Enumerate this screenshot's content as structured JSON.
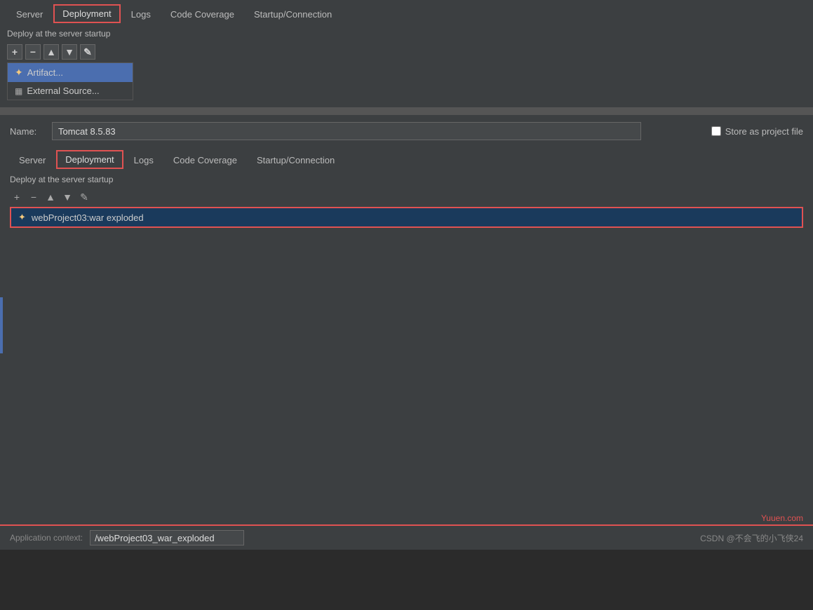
{
  "top_panel": {
    "tabs": [
      {
        "label": "Server",
        "active": false
      },
      {
        "label": "Deployment",
        "active": true
      },
      {
        "label": "Logs",
        "active": false
      },
      {
        "label": "Code Coverage",
        "active": false
      },
      {
        "label": "Startup/Connection",
        "active": false
      }
    ],
    "deploy_label": "Deploy at the server startup",
    "toolbar": {
      "add": "+",
      "remove": "−",
      "up": "▲",
      "down": "▼",
      "edit": "✎"
    },
    "dropdown": {
      "items": [
        {
          "label": "Artifact...",
          "selected": true,
          "icon": "artifact"
        },
        {
          "label": "External Source...",
          "selected": false,
          "icon": "ext"
        }
      ]
    }
  },
  "bottom_panel": {
    "name_label": "Name:",
    "name_value": "Tomcat 8.5.83",
    "store_label": "Store as project file",
    "tabs": [
      {
        "label": "Server",
        "active": false
      },
      {
        "label": "Deployment",
        "active": true
      },
      {
        "label": "Logs",
        "active": false
      },
      {
        "label": "Code Coverage",
        "active": false
      },
      {
        "label": "Startup/Connection",
        "active": false
      }
    ],
    "deploy_label": "Deploy at the server startup",
    "toolbar": {
      "add": "+",
      "remove": "−",
      "up": "▲",
      "down": "▼",
      "edit": "✎"
    },
    "deployment_items": [
      {
        "label": "webProject03:war exploded",
        "icon": "artifact"
      }
    ],
    "app_context_label": "Application context:",
    "app_context_value": "/webProject03_war_exploded",
    "watermark_yuuen": "Yuuen.com",
    "watermark_csdn": "CSDN @不会飞的小飞侠24"
  }
}
